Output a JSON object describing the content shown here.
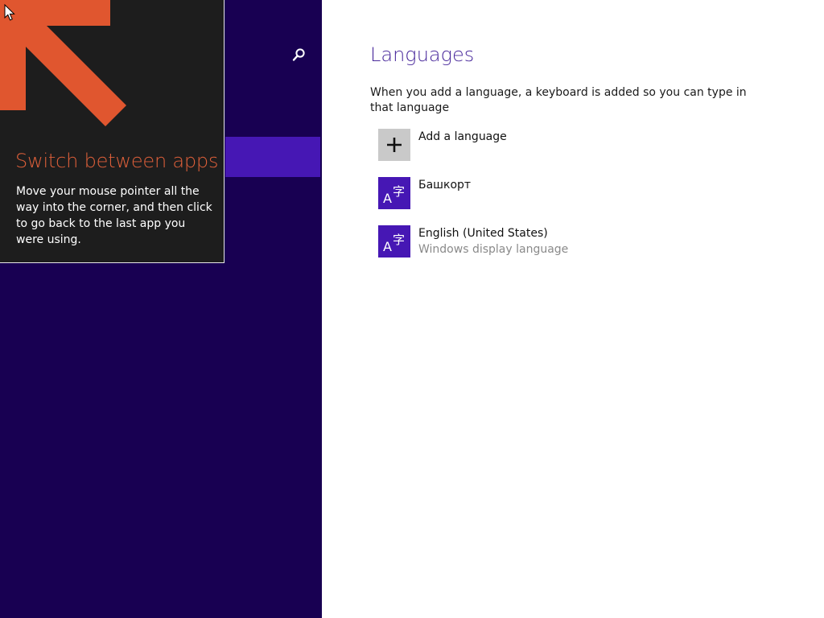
{
  "tip": {
    "title": "Switch between apps",
    "body": "Move your mouse pointer all the way into the corner, and then click to go back to the last app you were using."
  },
  "nav": {
    "search_icon": "search-icon"
  },
  "content": {
    "title": "Languages",
    "description": "When you add a language, a keyboard is added so you can type in that language",
    "add_language_label": "Add a language",
    "languages": [
      {
        "name": "Башкорт",
        "subtitle": ""
      },
      {
        "name": "English (United States)",
        "subtitle": "Windows display language"
      }
    ]
  },
  "colors": {
    "nav_background": "#180052",
    "nav_selected": "#4617b4",
    "tip_title": "#e0603a",
    "accent": "#4617b4"
  }
}
